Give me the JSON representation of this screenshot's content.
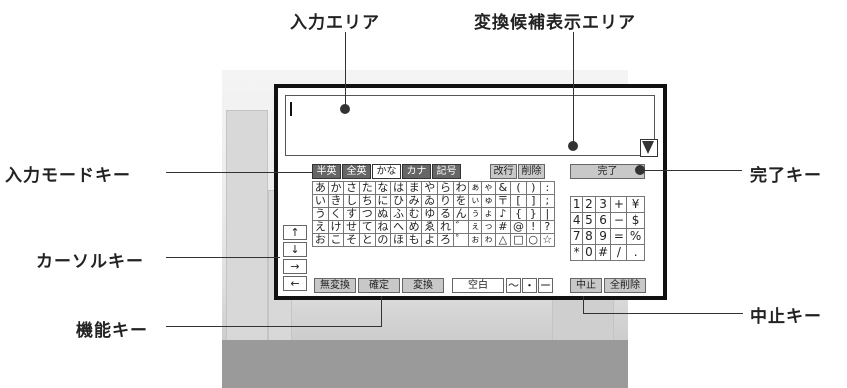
{
  "callouts": {
    "input_area": "入力エリア",
    "candidate_area": "変換候補表示エリア",
    "input_mode_keys": "入力モードキー",
    "cursor_keys": "カーソルキー",
    "function_keys": "機能キー",
    "done_key": "完了キー",
    "cancel_key": "中止キー"
  },
  "mode_keys": [
    "半英",
    "全英",
    "かな",
    "カナ",
    "記号"
  ],
  "selected_mode_index": 2,
  "linefeed_key": "改行",
  "delete_key": "削除",
  "done_key": "完了",
  "kana_rows": [
    [
      "あ",
      "か",
      "さ",
      "た",
      "な",
      "は",
      "ま",
      "や",
      "ら",
      "わ",
      "ぁ",
      "ゃ",
      "&",
      "(",
      ")",
      ":"
    ],
    [
      "い",
      "き",
      "し",
      "ち",
      "に",
      "ひ",
      "み",
      "ゐ",
      "り",
      "を",
      "ぃ",
      "ゅ",
      "〒",
      "[",
      "]",
      ";"
    ],
    [
      "う",
      "く",
      "す",
      "つ",
      "ぬ",
      "ふ",
      "む",
      "ゆ",
      "る",
      "ん",
      "ぅ",
      "ょ",
      "♪",
      "{",
      "}",
      "|"
    ],
    [
      "え",
      "け",
      "せ",
      "て",
      "ね",
      "へ",
      "め",
      "ゑ",
      "れ",
      "゛",
      "ぇ",
      "っ",
      "#",
      "@",
      "!",
      "?"
    ],
    [
      "お",
      "こ",
      "そ",
      "と",
      "の",
      "ほ",
      "も",
      "よ",
      "ろ",
      "゜",
      "ぉ",
      "ゎ",
      "△",
      "□",
      "○",
      "☆"
    ]
  ],
  "cursor_keys": [
    "↑",
    "↓",
    "→",
    "←"
  ],
  "function_keys": [
    "無変換",
    "確定",
    "変換"
  ],
  "space_key": "空白",
  "bottom_symbols": [
    "〜",
    "・",
    "ー"
  ],
  "numpad": [
    [
      "1",
      "2",
      "3",
      "+",
      "¥"
    ],
    [
      "4",
      "5",
      "6",
      "−",
      "$"
    ],
    [
      "7",
      "8",
      "9",
      "=",
      "%"
    ],
    [
      "*",
      "0",
      "#",
      "/",
      "."
    ]
  ],
  "cancel_key": "中止",
  "clear_all_key": "全削除"
}
